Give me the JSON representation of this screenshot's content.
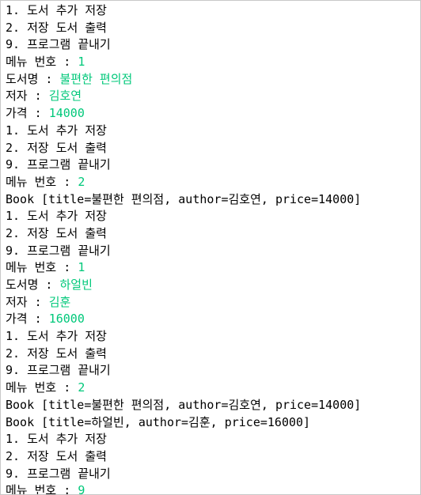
{
  "colors": {
    "output_text": "#000000",
    "user_input": "#00c87a",
    "background": "#ffffff"
  },
  "console": {
    "lines": [
      {
        "text": "1. 도서 추가 저장"
      },
      {
        "text": "2. 저장 도서 출력"
      },
      {
        "text": "9. 프로그램 끝내기"
      },
      {
        "prompt": "메뉴 번호 : ",
        "input": "1"
      },
      {
        "prompt": "도서명 : ",
        "input": "불편한 편의점"
      },
      {
        "prompt": "저자 : ",
        "input": "김호연"
      },
      {
        "prompt": "가격 : ",
        "input": "14000"
      },
      {
        "text": "1. 도서 추가 저장"
      },
      {
        "text": "2. 저장 도서 출력"
      },
      {
        "text": "9. 프로그램 끝내기"
      },
      {
        "prompt": "메뉴 번호 : ",
        "input": "2"
      },
      {
        "text": "Book [title=불편한 편의점, author=김호연, price=14000]"
      },
      {
        "text": "1. 도서 추가 저장"
      },
      {
        "text": "2. 저장 도서 출력"
      },
      {
        "text": "9. 프로그램 끝내기"
      },
      {
        "prompt": "메뉴 번호 : ",
        "input": "1"
      },
      {
        "prompt": "도서명 : ",
        "input": "하얼빈"
      },
      {
        "prompt": "저자 : ",
        "input": "김훈"
      },
      {
        "prompt": "가격 : ",
        "input": "16000"
      },
      {
        "text": "1. 도서 추가 저장"
      },
      {
        "text": "2. 저장 도서 출력"
      },
      {
        "text": "9. 프로그램 끝내기"
      },
      {
        "prompt": "메뉴 번호 : ",
        "input": "2"
      },
      {
        "text": "Book [title=불편한 편의점, author=김호연, price=14000]"
      },
      {
        "text": "Book [title=하얼빈, author=김훈, price=16000]"
      },
      {
        "text": "1. 도서 추가 저장"
      },
      {
        "text": "2. 저장 도서 출력"
      },
      {
        "text": "9. 프로그램 끝내기"
      },
      {
        "prompt": "메뉴 번호 : ",
        "input": "9"
      }
    ]
  }
}
